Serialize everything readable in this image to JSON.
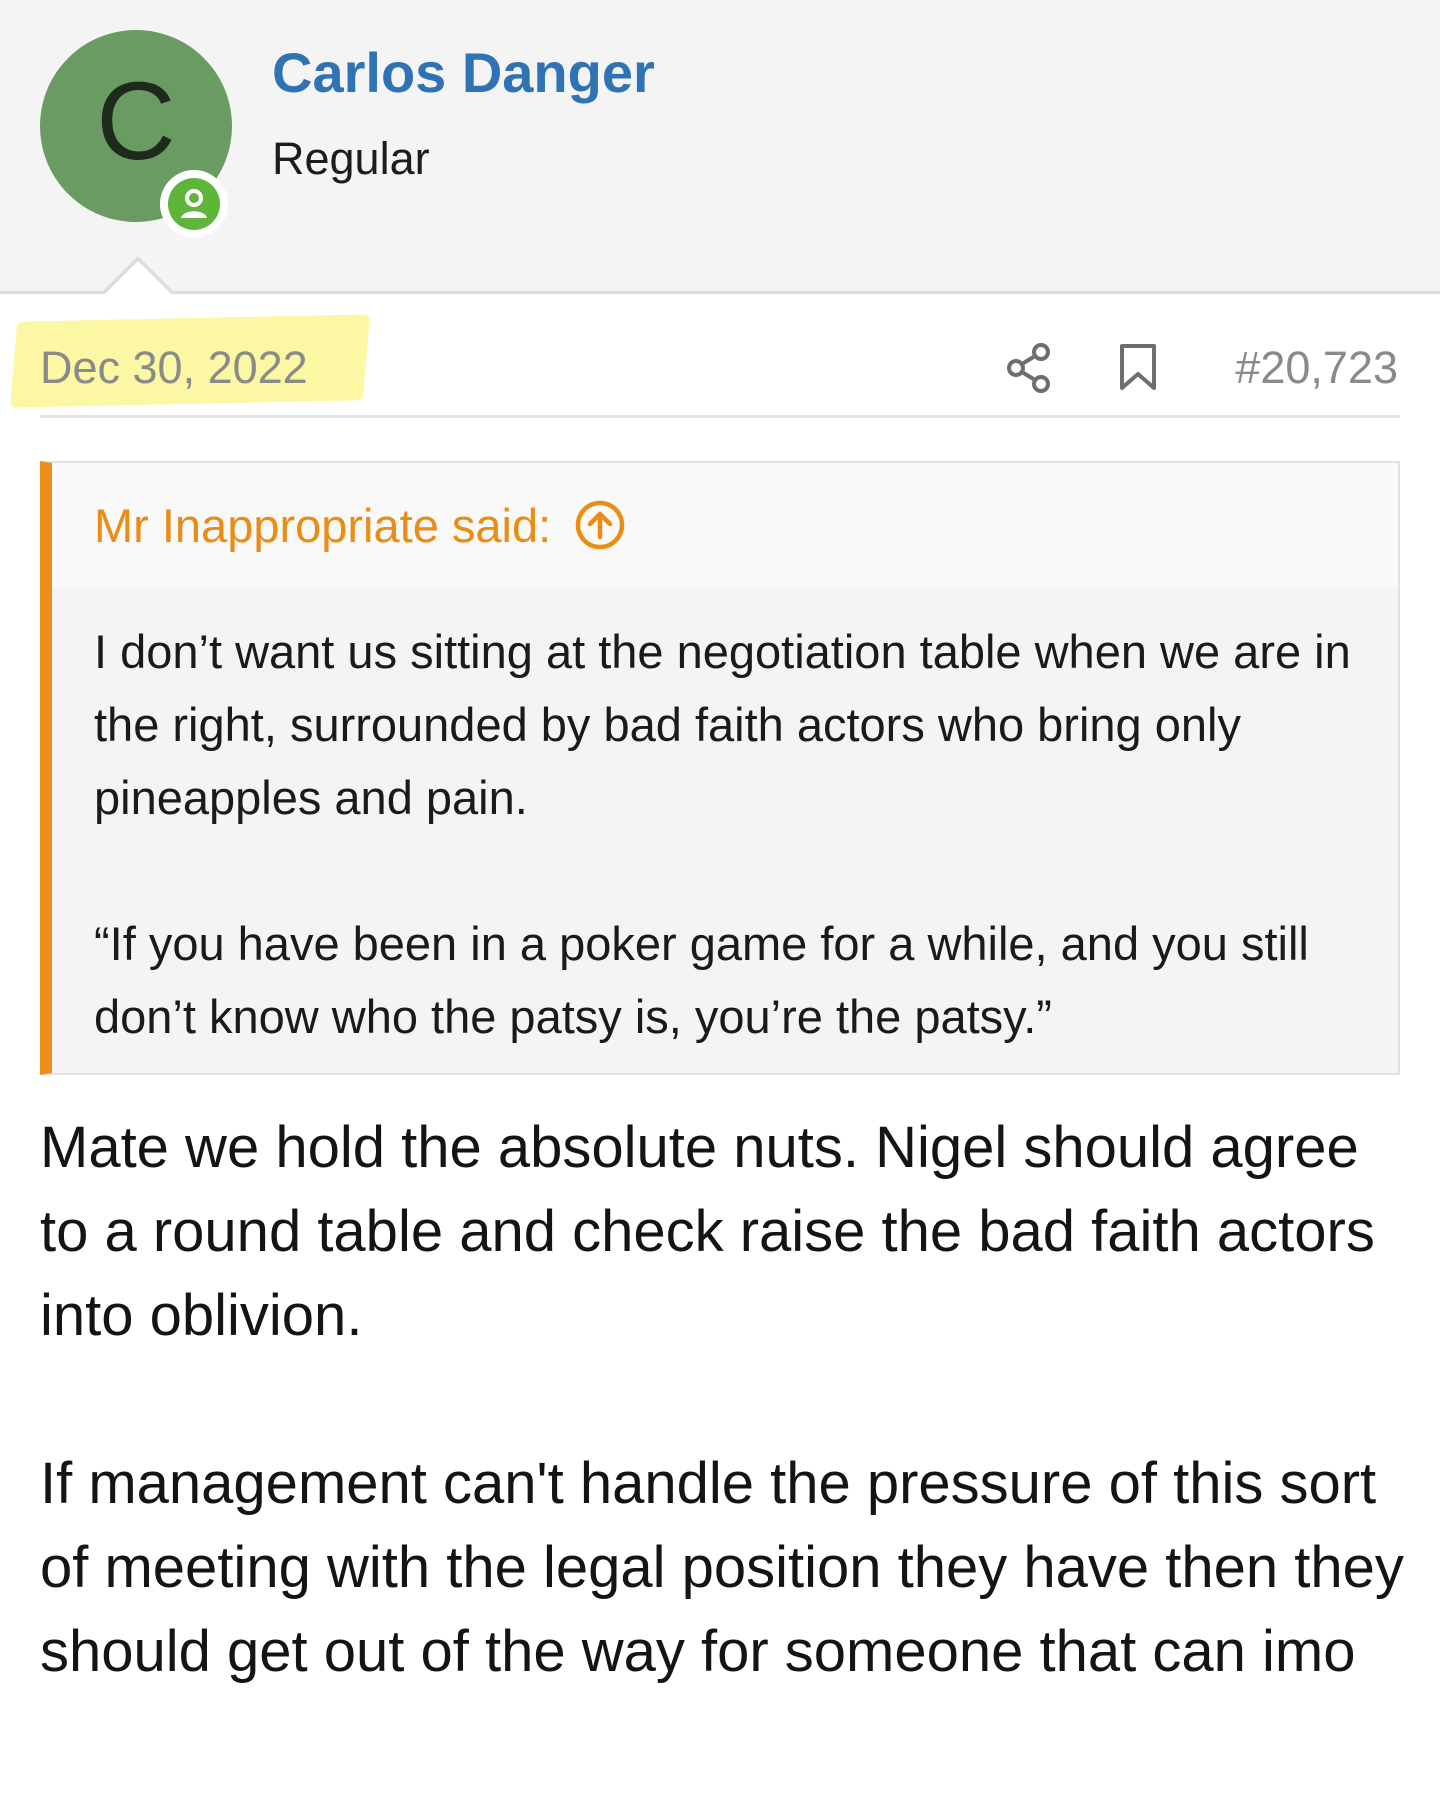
{
  "user": {
    "avatar_letter": "C",
    "name": "Carlos Danger",
    "title": "Regular",
    "online_icon": "user-circle-icon",
    "avatar_color": "#6a9b62",
    "online_color": "#5fb53a"
  },
  "post": {
    "date": "Dec 30, 2022",
    "number": "#20,723",
    "share_icon": "share-icon",
    "bookmark_icon": "bookmark-icon",
    "highlight_color": "#fbf7a2"
  },
  "quote": {
    "author_label": "Mr Inappropriate said:",
    "jump_icon": "arrow-up-circle-icon",
    "accent_color": "#ec8e1b",
    "paragraphs": [
      "I don’t want us sitting at the negotiation table when we are in the right, surrounded by bad faith actors who bring only pineapples and pain.",
      "“If you have been in a poker game for a while, and you still don’t know who the patsy is, you’re the patsy.”"
    ]
  },
  "body": {
    "paragraphs": [
      "Mate we hold the absolute nuts. Nigel should agree to a round table and check raise the bad faith actors into oblivion.",
      "If management can't handle the pressure of this sort of meeting with the legal position they have then they should get out of the way for someone that can imo"
    ]
  },
  "colors": {
    "username": "#2f73b4",
    "meta_text": "#8a8a8a"
  }
}
